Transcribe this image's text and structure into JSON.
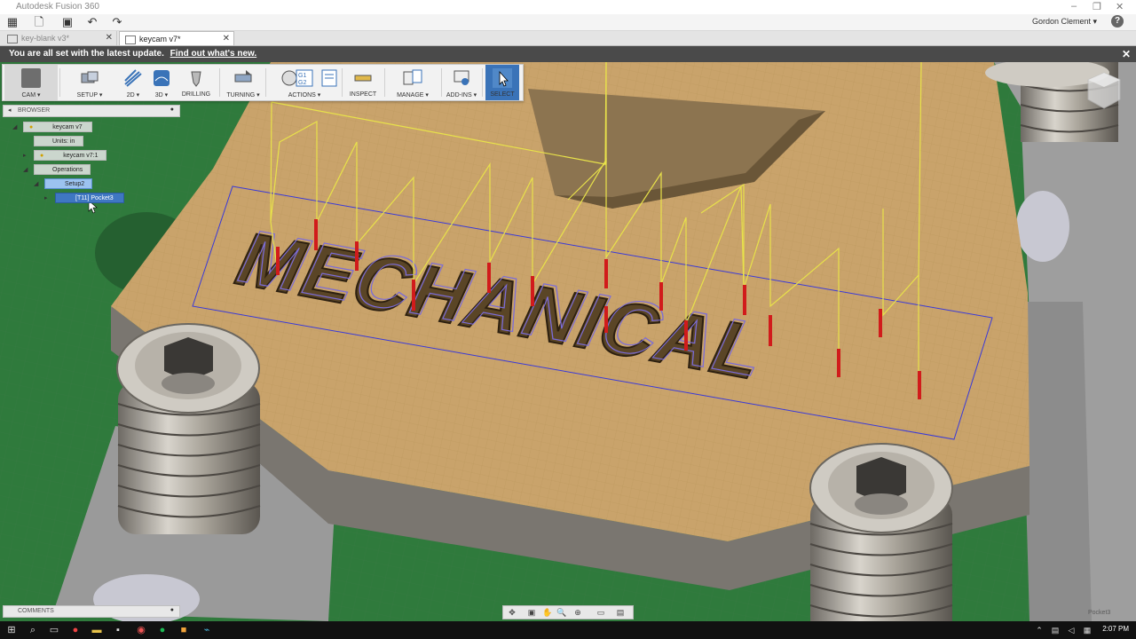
{
  "window": {
    "title": "Autodesk Fusion 360"
  },
  "top_toolbar": {
    "user": "Gordon Clement ▾",
    "help": "?"
  },
  "tabs": [
    {
      "label": "key-blank v3*",
      "active": false
    },
    {
      "label": "keycam v7*",
      "active": true
    }
  ],
  "update_bar": {
    "message": "You are all set with the latest update.",
    "link": "Find out what's new."
  },
  "ribbon": [
    {
      "label": "CAM ▾",
      "icon": "cam-workspace-icon"
    },
    {
      "label": "SETUP ▾",
      "icon": "setup-icon"
    },
    {
      "label": "2D ▾",
      "icon": "2d-icon"
    },
    {
      "label": "3D ▾",
      "icon": "3d-icon"
    },
    {
      "label": "DRILLING",
      "icon": "drill-icon"
    },
    {
      "label": "TURNING ▾",
      "icon": "turning-icon"
    },
    {
      "label": "ACTIONS ▾",
      "icon": "actions-icon"
    },
    {
      "label": "INSPECT",
      "icon": "inspect-icon"
    },
    {
      "label": "MANAGE ▾",
      "icon": "manage-icon"
    },
    {
      "label": "ADD-INS ▾",
      "icon": "addins-icon"
    },
    {
      "label": "SELECT",
      "icon": "select-icon"
    }
  ],
  "browser": {
    "title": "BROWSER",
    "nodes": [
      {
        "label": "keycam v7"
      },
      {
        "label": "Units: in"
      },
      {
        "label": "keycam v7:1"
      },
      {
        "label": "Operations"
      },
      {
        "label": "Setup2"
      },
      {
        "label": "[T11] Pocket3"
      }
    ]
  },
  "comments": {
    "title": "COMMENTS"
  },
  "model": {
    "engraved_text": "MECHANICAL",
    "corner_label": "Pocket3",
    "colors": {
      "stock": "#c9a36b",
      "toolpath": "#e8e24a",
      "plunge": "#d11b1b",
      "boundary": "#3a3ad8",
      "ground": "#2f6e3a"
    }
  },
  "taskbar": {
    "time": "2:07 PM"
  }
}
